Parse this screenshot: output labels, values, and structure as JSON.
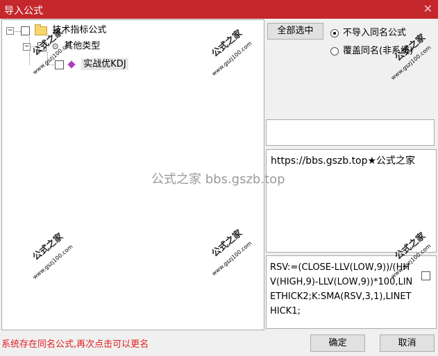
{
  "window": {
    "title": "导入公式",
    "close_glyph": "✕"
  },
  "tree": {
    "root": {
      "expander": "−",
      "label": "技术指标公式"
    },
    "group": {
      "expander": "−",
      "label": "其他类型"
    },
    "leaf": {
      "label": "实战优KDJ"
    }
  },
  "options": {
    "select_all_label": "全部选中",
    "radio_skip_label": "不导入同名公式",
    "radio_skip_checked": true,
    "radio_overwrite_label": "覆盖同名(非系统)",
    "radio_overwrite_checked": false
  },
  "info_text": "https://bbs.gszb.top★公式之家",
  "formula_text": "RSV:=(CLOSE-LLV(LOW,9))/(HHV(HIGH,9)-LLV(LOW,9))*100,LINETHICK2;K:SMA(RSV,3,1),LINETHICK1;",
  "status_message": "系统存在同名公式,再次点击可以更名",
  "buttons": {
    "ok": "确定",
    "cancel": "取消"
  },
  "watermark": {
    "text": "公式之家",
    "url": "www.gszj100.com",
    "center": "公式之家 bbs.gszb.top"
  }
}
